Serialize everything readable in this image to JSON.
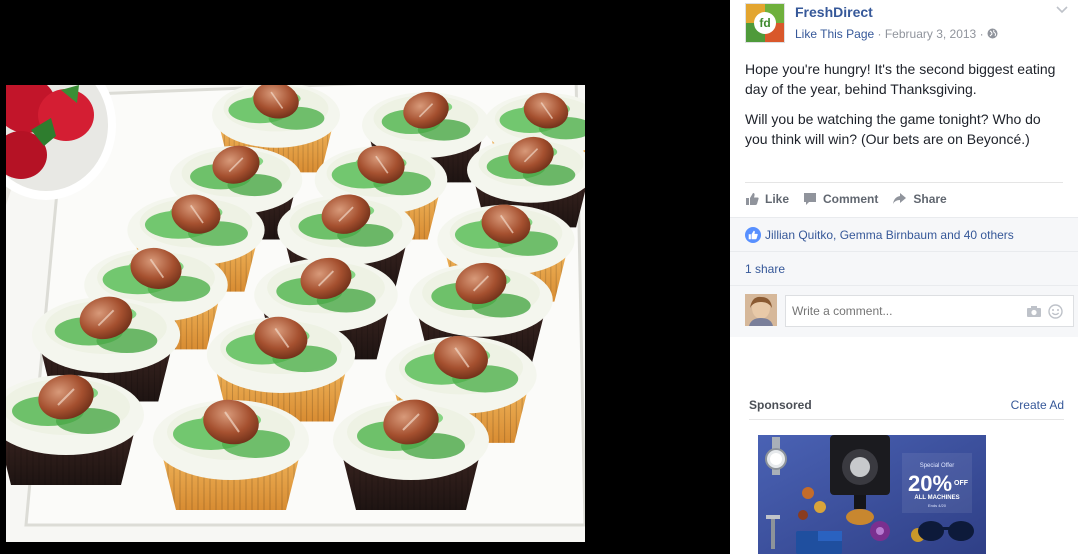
{
  "post": {
    "page_name": "FreshDirect",
    "avatar_text": "fd",
    "like_page": "Like This Page",
    "separator": " · ",
    "date": "February 3, 2013",
    "paragraph1": "Hope you're hungry! It's the second biggest eating day of the year, behind Thanksgiving.",
    "paragraph2": "Will you be watching the game tonight? Who do you think will win? (Our bets are on Beyoncé.)"
  },
  "actions": {
    "like": "Like",
    "comment": "Comment",
    "share": "Share"
  },
  "reactions": {
    "text": "Jillian Quitko, Gemma Birnbaum and 40 others"
  },
  "shares": {
    "text": "1 share"
  },
  "comment_box": {
    "placeholder": "Write a comment..."
  },
  "sponsored": {
    "label": "Sponsored",
    "create_ad": "Create Ad"
  },
  "ad": {
    "small_text": "Special Offer",
    "big_text": "20%",
    "off_text": "OFF",
    "sub_text": "ALL MACHINES",
    "tiny_text": "Ends 4/20"
  },
  "colors": {
    "link": "#365899",
    "meta": "#90949c",
    "text": "#1d2129",
    "badge": "#5890ff",
    "ad_bg": "#3b4f9c"
  }
}
